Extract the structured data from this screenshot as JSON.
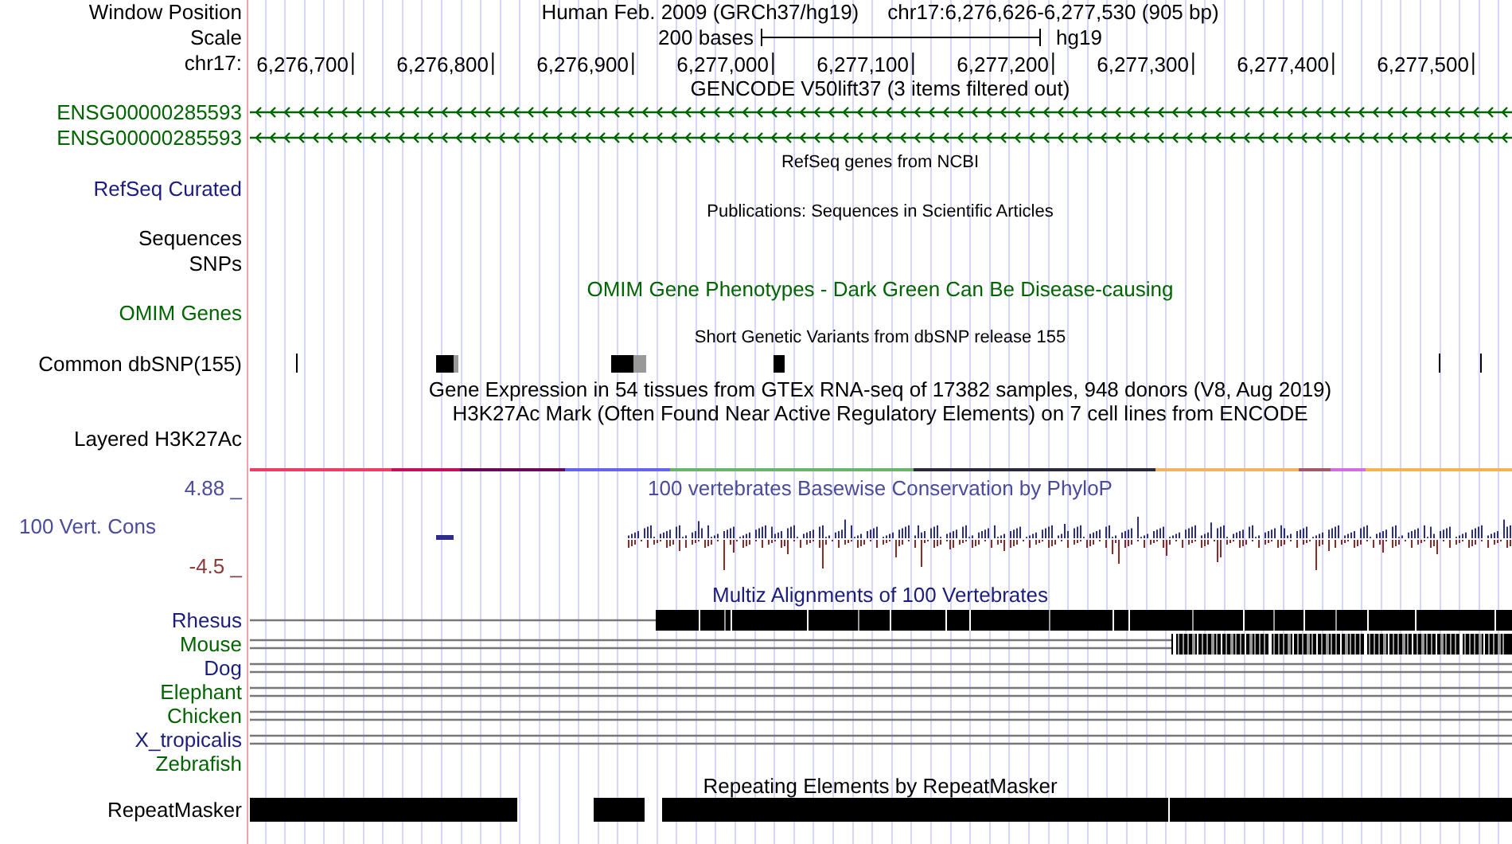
{
  "rows": [
    {
      "kind": "header",
      "label": "Window Position",
      "title": "Human Feb. 2009 (GRCh37/hg19)",
      "position": "chr17:6,276,626-6,277,530 (905 bp)"
    },
    {
      "kind": "scale",
      "label": "Scale",
      "text": "200 bases",
      "assembly": "hg19"
    },
    {
      "kind": "ruler",
      "label": "chr17:",
      "ticks": [
        "6,276,700",
        "6,276,800",
        "6,276,900",
        "6,277,000",
        "6,277,100",
        "6,277,200",
        "6,277,300",
        "6,277,400",
        "6,277,500"
      ]
    },
    {
      "kind": "title",
      "title": "GENCODE V50lift37 (3 items filtered out)"
    },
    {
      "kind": "gene",
      "label": "ENSG00000285593",
      "color": "#006400"
    },
    {
      "kind": "gene",
      "label": "ENSG00000285593",
      "color": "#006400"
    },
    {
      "kind": "subtitle",
      "title": "RefSeq genes from NCBI"
    },
    {
      "kind": "label",
      "label": "RefSeq Curated",
      "color": "#1c1c7c"
    },
    {
      "kind": "subtitle",
      "title": "Publications: Sequences in Scientific Articles"
    },
    {
      "kind": "label",
      "label": "Sequences"
    },
    {
      "kind": "label",
      "label": "SNPs"
    },
    {
      "kind": "title",
      "title": "OMIM Gene Phenotypes - Dark Green Can Be Disease-causing",
      "color": "#006400"
    },
    {
      "kind": "label",
      "label": "OMIM Genes",
      "color": "#006400"
    },
    {
      "kind": "subtitle",
      "title": "Short Genetic Variants from dbSNP release 155"
    },
    {
      "kind": "snp",
      "label": "Common dbSNP(155)"
    },
    {
      "kind": "title",
      "title": "Gene Expression in 54 tissues from GTEx RNA-seq of 17382 samples, 948 donors (V8, Aug 2019)"
    },
    {
      "kind": "title",
      "title": "H3K27Ac Mark (Often Found Near Active Regulatory Elements) on 7 cell lines from ENCODE"
    },
    {
      "kind": "layered",
      "label": "Layered H3K27Ac"
    },
    {
      "kind": "phylop",
      "title": "100 vertebrates Basewise Conservation by PhyloP",
      "label": "100 Vert. Cons",
      "max": "4.88 _",
      "min": "-4.5 _",
      "color": "#4b4b9b"
    },
    {
      "kind": "title",
      "title": "Multiz Alignments of 100 Vertebrates",
      "color": "#1c1c7c"
    },
    {
      "kind": "species",
      "label": "Rhesus",
      "color": "#1c1c7c"
    },
    {
      "kind": "species",
      "label": "Mouse",
      "color": "#006400"
    },
    {
      "kind": "species",
      "label": "Dog",
      "color": "#1c1c7c"
    },
    {
      "kind": "species",
      "label": "Elephant",
      "color": "#006400"
    },
    {
      "kind": "species",
      "label": "Chicken",
      "color": "#006400"
    },
    {
      "kind": "species",
      "label": "X_tropicalis",
      "color": "#1c1c7c"
    },
    {
      "kind": "species",
      "label": "Zebrafish",
      "color": "#006400"
    },
    {
      "kind": "repeat_title",
      "title": "Repeating Elements by RepeatMasker"
    },
    {
      "kind": "repeat",
      "label": "RepeatMasker"
    }
  ]
}
